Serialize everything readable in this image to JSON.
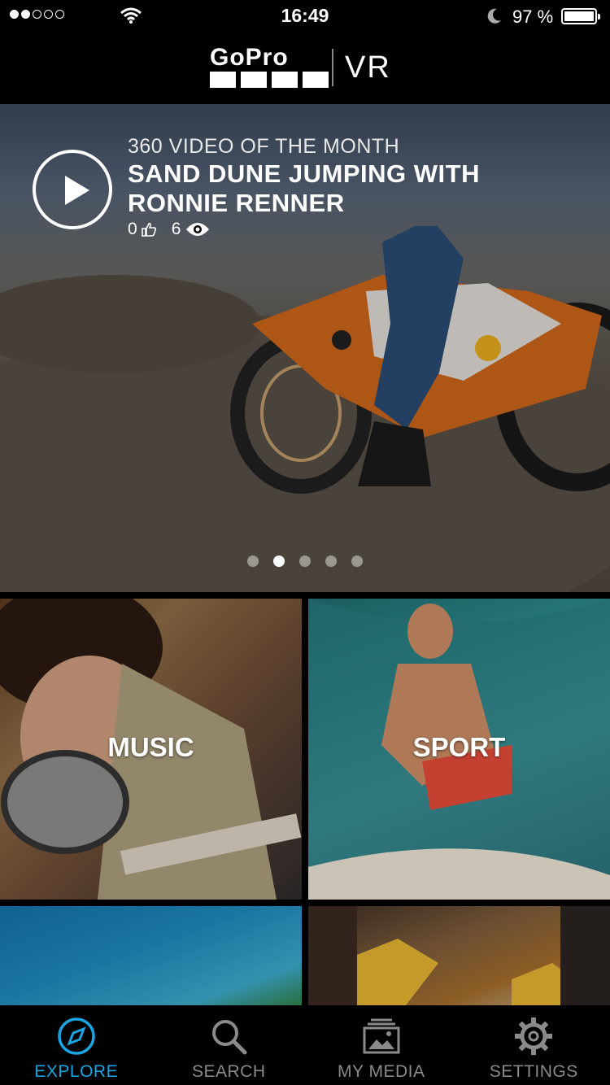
{
  "status_bar": {
    "time": "16:49",
    "battery_percent": "97 %",
    "signal_bars_filled": 2,
    "signal_bars_total": 5
  },
  "header": {
    "logo_text": "GoPro",
    "logo_suffix": "VR"
  },
  "hero": {
    "kicker": "360 VIDEO OF THE MONTH",
    "title": "SAND DUNE JUMPING WITH RONNIE RENNER",
    "likes": "0",
    "views": "6",
    "carousel_pages": 5,
    "carousel_active_index": 1
  },
  "categories": [
    {
      "label": "MUSIC"
    },
    {
      "label": "SPORT"
    },
    {
      "label": ""
    },
    {
      "label": ""
    }
  ],
  "tabs": [
    {
      "label": "EXPLORE",
      "icon": "compass-icon",
      "active": true
    },
    {
      "label": "SEARCH",
      "icon": "search-icon",
      "active": false
    },
    {
      "label": "MY MEDIA",
      "icon": "media-icon",
      "active": false
    },
    {
      "label": "SETTINGS",
      "icon": "gear-icon",
      "active": false
    }
  ],
  "colors": {
    "accent": "#1aa4e0",
    "inactive_tab": "#8a8a8a",
    "background": "#000000"
  }
}
